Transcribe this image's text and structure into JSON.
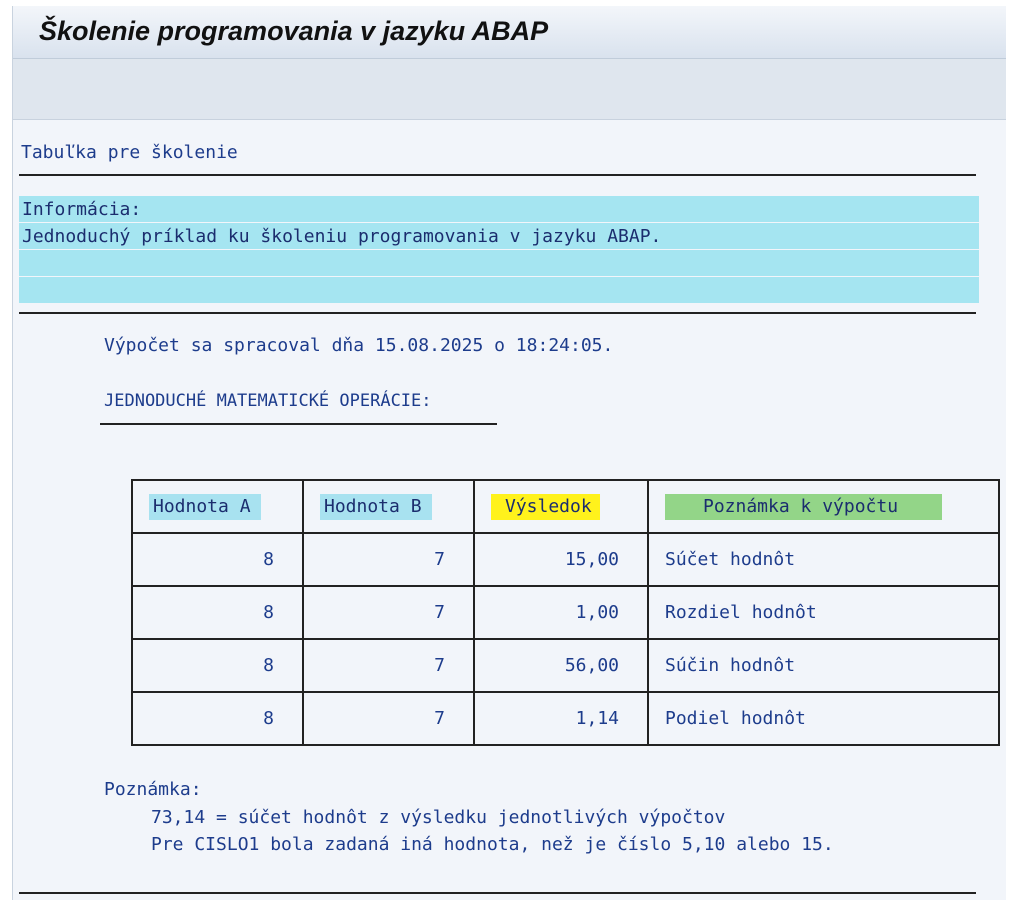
{
  "window": {
    "title": "Školenie programovania v jazyku ABAP"
  },
  "report": {
    "heading": "Tabuľka pre školenie",
    "info": {
      "label": "Informácia:",
      "text": "Jednoduchý príklad ku školeniu programovania v jazyku ABAP."
    },
    "computed_line": "Výpočet sa spracoval dňa 15.08.2025 o 18:24:05.",
    "section_title": "JEDNODUCHÉ MATEMATICKÉ OPERÁCIE:",
    "table": {
      "headers": [
        "Hodnota A",
        "Hodnota B",
        "Výsledok",
        "Poznámka k výpočtu"
      ],
      "header_colors": [
        "#a8e2f0",
        "#a8e2f0",
        "#fff21c",
        "#93d588"
      ],
      "rows": [
        {
          "a": "8",
          "b": "7",
          "result": "15,00",
          "note": "Súčet hodnôt"
        },
        {
          "a": "8",
          "b": "7",
          "result": "1,00",
          "note": "Rozdiel hodnôt"
        },
        {
          "a": "8",
          "b": "7",
          "result": "56,00",
          "note": "Súčin hodnôt"
        },
        {
          "a": "8",
          "b": "7",
          "result": "1,14",
          "note": "Podiel hodnôt"
        }
      ]
    },
    "notes": {
      "label": "Poznámka:",
      "line1": "73,14  = súčet hodnôt z výsledku jednotlivých výpočtov",
      "line2": "Pre CISLO1 bola zadaná iná hodnota, než je číslo 5,10 alebo 15."
    }
  }
}
